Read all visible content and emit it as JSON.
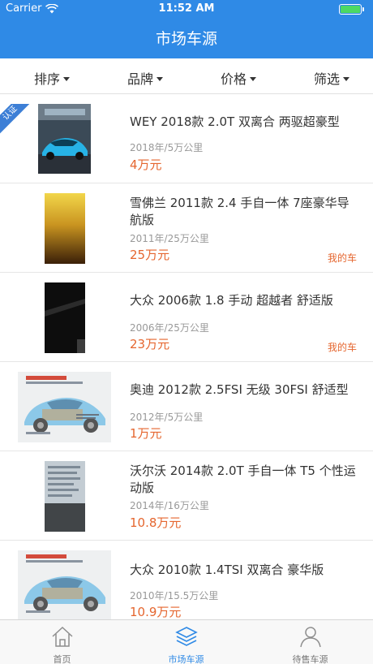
{
  "status_bar": {
    "carrier": "Carrier",
    "time": "11:52 AM"
  },
  "nav": {
    "title": "市场车源"
  },
  "filters": [
    {
      "label": "排序"
    },
    {
      "label": "品牌"
    },
    {
      "label": "价格"
    },
    {
      "label": "筛选"
    }
  ],
  "listings": [
    {
      "title": "WEY 2018款 2.0T 双离合  两驱超豪型",
      "meta": "2018年/5万公里",
      "price": "4万元",
      "badge": "认证",
      "tag": ""
    },
    {
      "title": "雪佛兰 2011款 2.4 手自一体 7座豪华导航版",
      "meta": "2011年/25万公里",
      "price": "25万元",
      "badge": "",
      "tag": "我的车"
    },
    {
      "title": "大众 2006款 1.8 手动 超越者 舒适版",
      "meta": "2006年/25万公里",
      "price": "23万元",
      "badge": "",
      "tag": "我的车"
    },
    {
      "title": "奥迪 2012款 2.5FSI 无级 30FSI 舒适型",
      "meta": "2012年/5万公里",
      "price": "1万元",
      "badge": "",
      "tag": ""
    },
    {
      "title": "沃尔沃 2014款 2.0T 手自一体 T5 个性运动版",
      "meta": "2014年/16万公里",
      "price": "10.8万元",
      "badge": "",
      "tag": ""
    },
    {
      "title": "大众 2010款 1.4TSI 双离合 豪华版",
      "meta": "2010年/15.5万公里",
      "price": "10.9万元",
      "badge": "",
      "tag": ""
    }
  ],
  "tabs": [
    {
      "label": "首页",
      "icon": "home-icon"
    },
    {
      "label": "市场车源",
      "icon": "layers-icon",
      "active": true
    },
    {
      "label": "待售车源",
      "icon": "person-icon"
    }
  ],
  "colors": {
    "primary": "#2f8ae6",
    "price": "#e5662f",
    "badge": "#3d7fd6"
  }
}
